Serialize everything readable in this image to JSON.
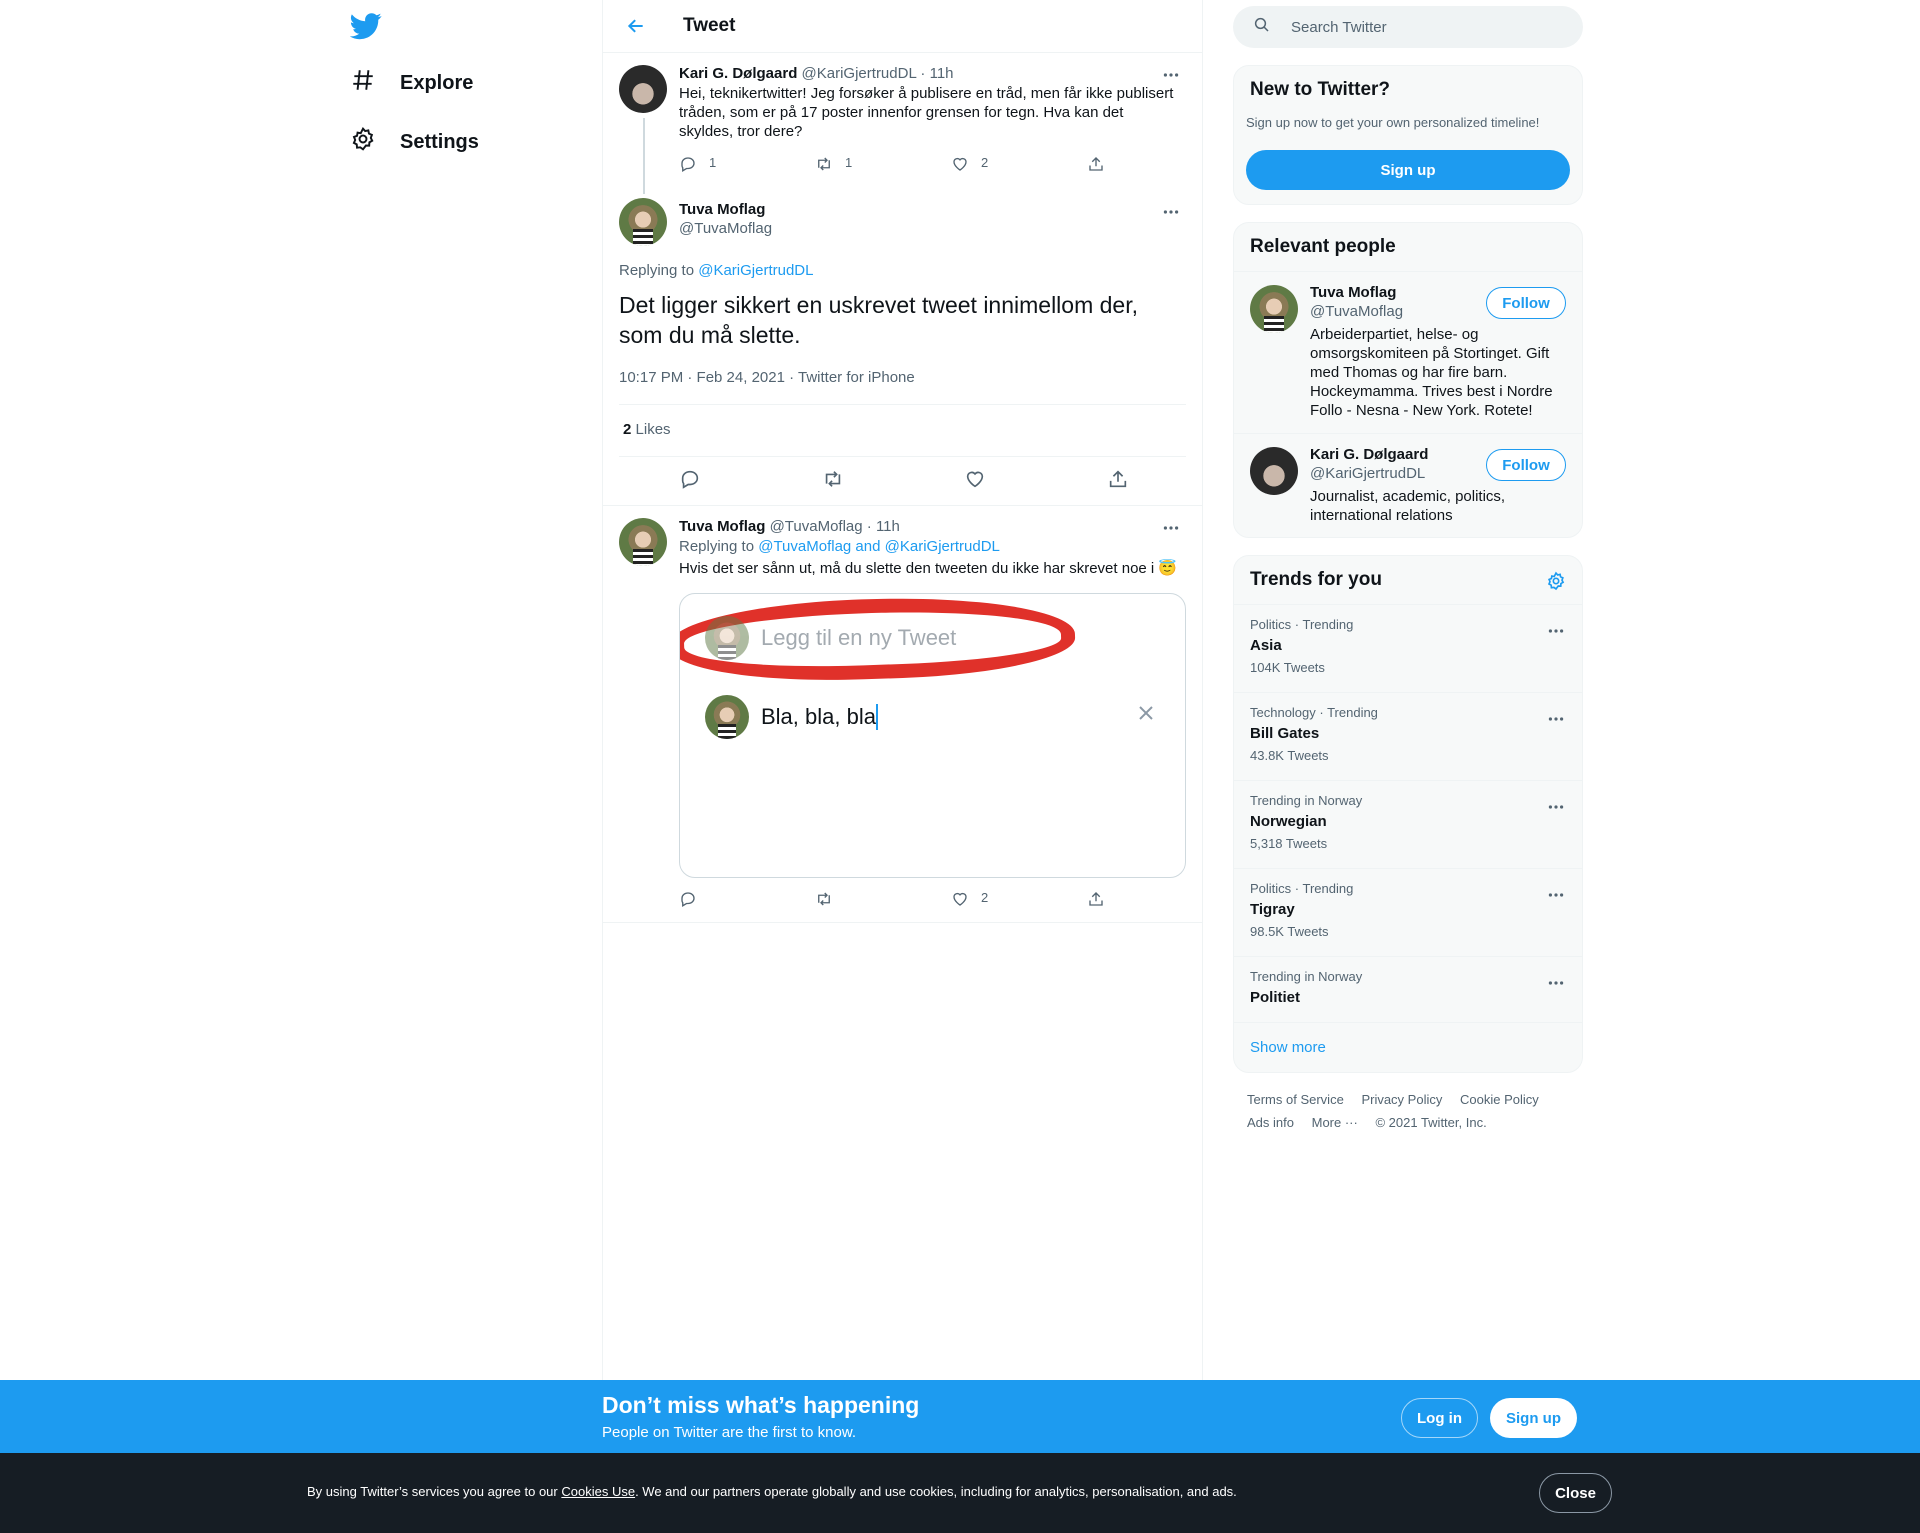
{
  "nav": {
    "explore_label": "Explore",
    "settings_label": "Settings"
  },
  "header": {
    "title": "Tweet"
  },
  "tweet1": {
    "name": "Kari G. Dølgaard",
    "handle": "@KariGjertrudDL",
    "time": "· 11h",
    "text": "Hei, teknikertwitter! Jeg forsøker å publisere en tråd, men får ikke publisert tråden, som er på 17 poster innenfor grensen for tegn. Hva kan det skyldes, tror dere?",
    "replies": "1",
    "retweets": "1",
    "likes": "2"
  },
  "focus": {
    "name": "Tuva Moflag",
    "handle": "@TuvaMoflag",
    "replying_prefix": "Replying to",
    "replying_to": "@KariGjertrudDL",
    "text": "Det ligger sikkert en uskrevet tweet innimellom der, som du må slette.",
    "timestamp": "10:17 PM · Feb 24, 2021 · Twitter for iPhone",
    "likes_count": "2",
    "likes_label": "Likes"
  },
  "tweet3": {
    "name": "Tuva Moflag",
    "handle": "@TuvaMoflag",
    "time": "· 11h",
    "replying_prefix": "Replying to",
    "replying_to": "@TuvaMoflag and @KariGjertrudDL",
    "text": "Hvis det ser sånn ut, må du slette den tweeten du ikke har skrevet noe i 😇",
    "media_placeholder": "Legg til en ny Tweet",
    "media_draft": "Bla, bla, bla",
    "likes": "2"
  },
  "search": {
    "placeholder": "Search Twitter"
  },
  "new_to_twitter": {
    "title": "New to Twitter?",
    "subtitle": "Sign up now to get your own personalized timeline!",
    "button": "Sign up"
  },
  "relevant": {
    "title": "Relevant people",
    "follow_label": "Follow",
    "people": [
      {
        "name": "Tuva Moflag",
        "handle": "@TuvaMoflag",
        "bio": "Arbeiderpartiet, helse- og omsorgskomiteen på Stortinget. Gift med Thomas og har fire barn. Hockeymamma. Trives best i Nordre Follo - Nesna - New York. Rotete!"
      },
      {
        "name": "Kari G. Dølgaard",
        "handle": "@KariGjertrudDL",
        "bio": "Journalist, academic, politics, international relations"
      }
    ]
  },
  "trends": {
    "title": "Trends for you",
    "items": [
      {
        "context": "Politics · Trending",
        "name": "Asia",
        "count": "104K Tweets"
      },
      {
        "context": "Technology · Trending",
        "name": "Bill Gates",
        "count": "43.8K Tweets"
      },
      {
        "context": "Trending in Norway",
        "name": "Norwegian",
        "count": "5,318 Tweets"
      },
      {
        "context": "Politics · Trending",
        "name": "Tigray",
        "count": "98.5K Tweets"
      },
      {
        "context": "Trending in Norway",
        "name": "Politiet",
        "count": ""
      }
    ],
    "show_more": "Show more"
  },
  "footer": {
    "terms": "Terms of Service",
    "privacy": "Privacy Policy",
    "cookie": "Cookie Policy",
    "ads": "Ads info",
    "more": "More ···",
    "copyright": "© 2021 Twitter, Inc."
  },
  "cta": {
    "heading": "Don’t miss what’s happening",
    "sub": "People on Twitter are the first to know.",
    "login": "Log in",
    "signup": "Sign up"
  },
  "cookie": {
    "before": "By using Twitter’s services you agree to our ",
    "link": "Cookies Use",
    "after": ". We and our partners operate globally and use cookies, including for analytics, personalisation, and ads.",
    "close": "Close"
  },
  "colors": {
    "accent": "#1d9bf0",
    "text": "#0f1419",
    "secondary": "#536471",
    "cookie_bg": "#161d24"
  },
  "icons": [
    "twitter-logo-icon",
    "hashtag-icon",
    "gear-icon",
    "back-arrow-icon",
    "search-icon",
    "reply-icon",
    "retweet-icon",
    "like-icon",
    "share-icon",
    "more-dots-icon",
    "close-icon"
  ]
}
